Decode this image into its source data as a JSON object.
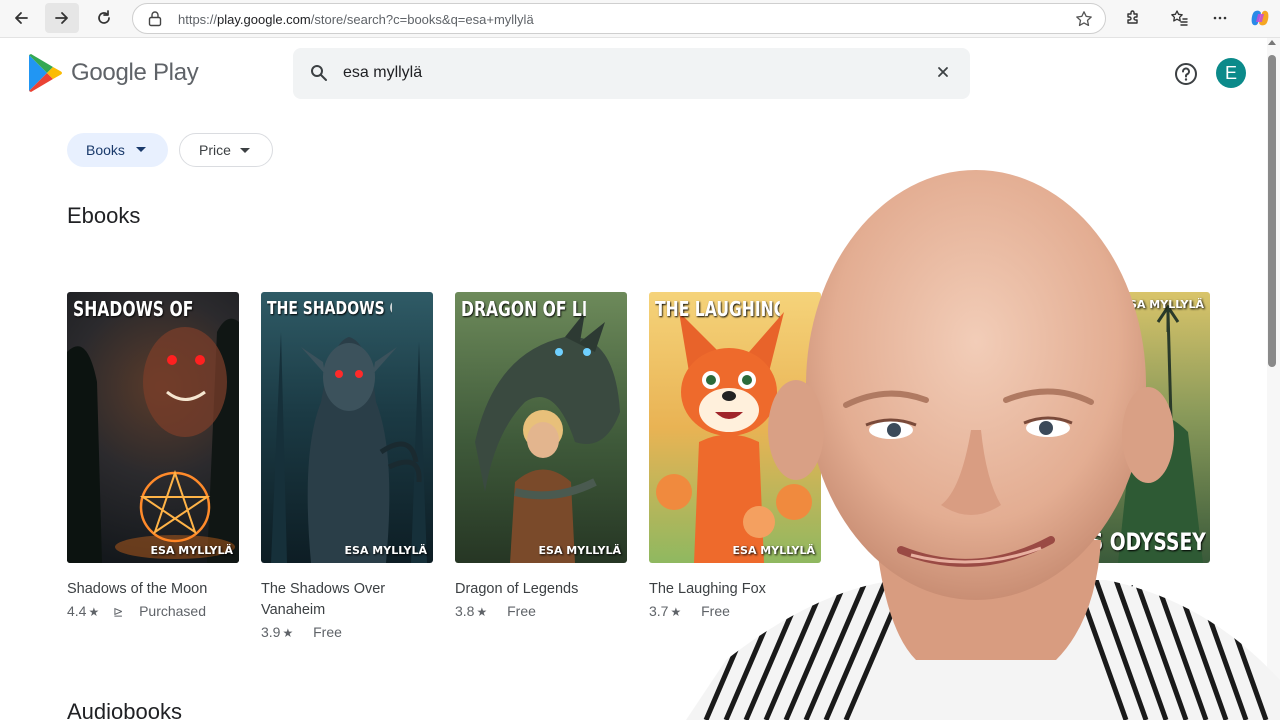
{
  "browser": {
    "url_prefix": "https://",
    "url_host": "play.google.com",
    "url_path": "/store/search?c=books&q=esa+myllylä"
  },
  "app": {
    "brand": "Google Play",
    "search_query": "esa myllylä",
    "avatar_letter": "E"
  },
  "filters": {
    "books": "Books",
    "price": "Price"
  },
  "sections": {
    "ebooks": "Ebooks",
    "audiobooks": "Audiobooks"
  },
  "books": [
    {
      "title": "Shadows of the Moon",
      "rating": "4.4",
      "status": "Purchased",
      "cover_title": "SHADOWS OF THE MOON",
      "cover_author": "ESA MYLLYLÄ"
    },
    {
      "title": "The Shadows Over Vanaheim",
      "rating": "3.9",
      "status": "Free",
      "cover_title": "THE SHADOWS OVER VANAHEIM",
      "cover_author": "ESA MYLLYLÄ"
    },
    {
      "title": "Dragon of Legends",
      "rating": "3.8",
      "status": "Free",
      "cover_title": "DRAGON OF LEGENDS",
      "cover_author": "ESA MYLLYLÄ"
    },
    {
      "title": "The Laughing Fox",
      "rating": "3.7",
      "status": "Free",
      "cover_title": "THE LAUGHING",
      "cover_author": "ESA MYLLYLÄ"
    },
    {
      "title": "yssey",
      "status": "urchased",
      "cover_title": "S ODYSSEY",
      "cover_author": "ESA MYLLYLÄ"
    }
  ],
  "colors": {
    "chip_active_bg": "#e8f0fe",
    "avatar_bg": "#0b8a8a"
  }
}
